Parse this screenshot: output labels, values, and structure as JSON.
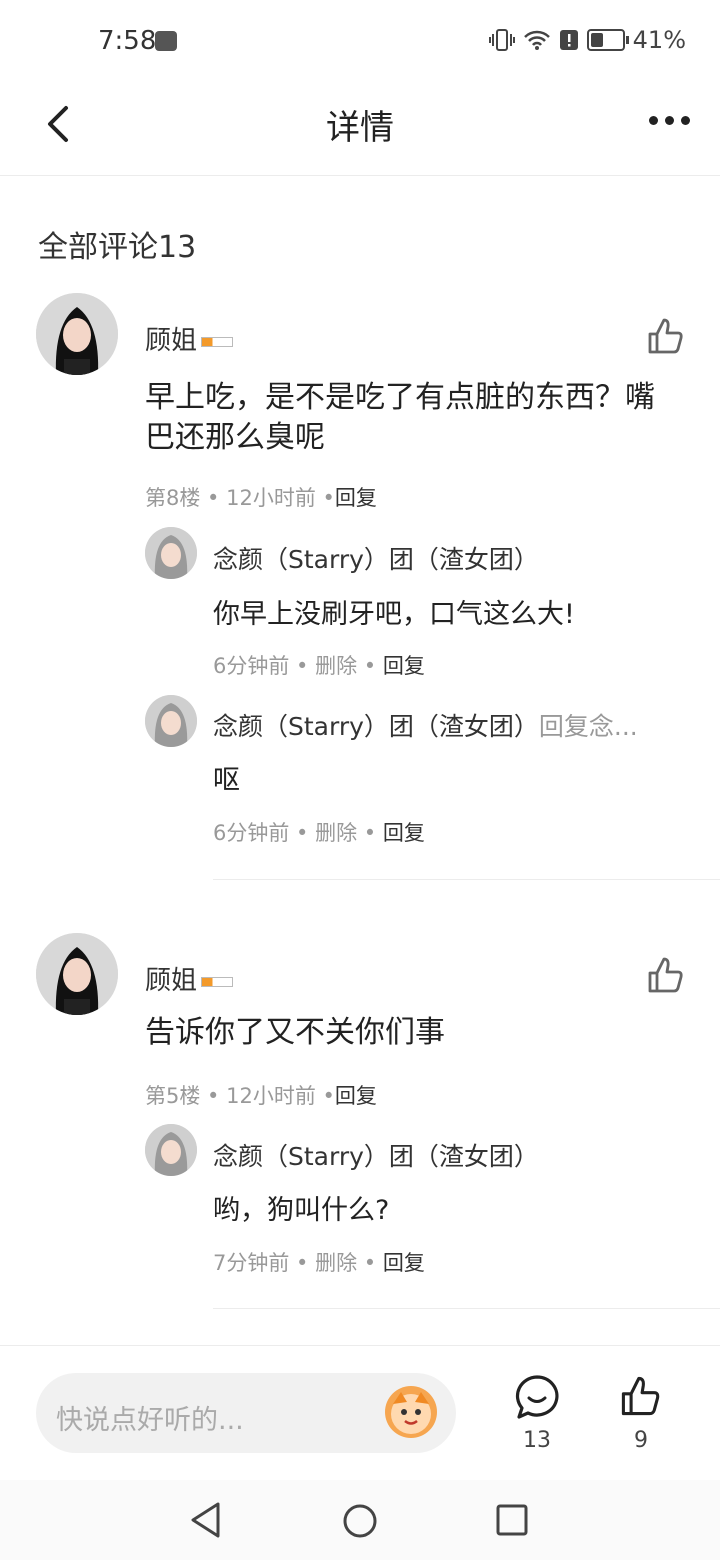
{
  "status": {
    "time": "7:58",
    "battery": "41%",
    "battery_level": 0.41
  },
  "header": {
    "title": "详情"
  },
  "section": {
    "title": "全部评论13"
  },
  "comments": [
    {
      "user": "顾姐",
      "text_line1": "早上吃，是不是吃了有点脏的东西？嘴",
      "text_line2": "巴还那么臭呢",
      "floor": "第8楼",
      "time": "12小时前",
      "reply_label": "回复",
      "replies": [
        {
          "user": "念颜（Starry）团（渣女团）",
          "reply_to": "",
          "text": "你早上没刷牙吧，口气这么大!",
          "time": "6分钟前",
          "delete": "删除",
          "reply": "回复"
        },
        {
          "user": "念颜（Starry）团（渣女团）",
          "reply_to": "回复念...",
          "text": "呕",
          "time": "6分钟前",
          "delete": "删除",
          "reply": "回复"
        }
      ]
    },
    {
      "user": "顾姐",
      "text_line1": "告诉你了又不关你们事",
      "floor": "第5楼",
      "time": "12小时前",
      "reply_label": "回复",
      "replies": [
        {
          "user": "念颜（Starry）团（渣女团）",
          "text": "哟，狗叫什么?",
          "time": "7分钟前",
          "delete": "删除",
          "reply": "回复"
        }
      ]
    }
  ],
  "bottom": {
    "placeholder": "快说点好听的...",
    "comment_count": "13",
    "like_count": "9"
  }
}
